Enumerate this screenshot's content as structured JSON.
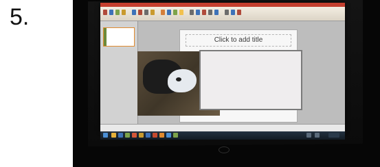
{
  "step_label": "5.",
  "slide": {
    "title_placeholder": "Click to add title"
  },
  "colors": {
    "titlebar": "#c43f2f",
    "thumbnail_border": "#e08a2e",
    "taskbar": "#1b2631"
  },
  "icons": [
    "windows-start-icon",
    "taskbar-app-icon",
    "powerpoint-icon"
  ]
}
